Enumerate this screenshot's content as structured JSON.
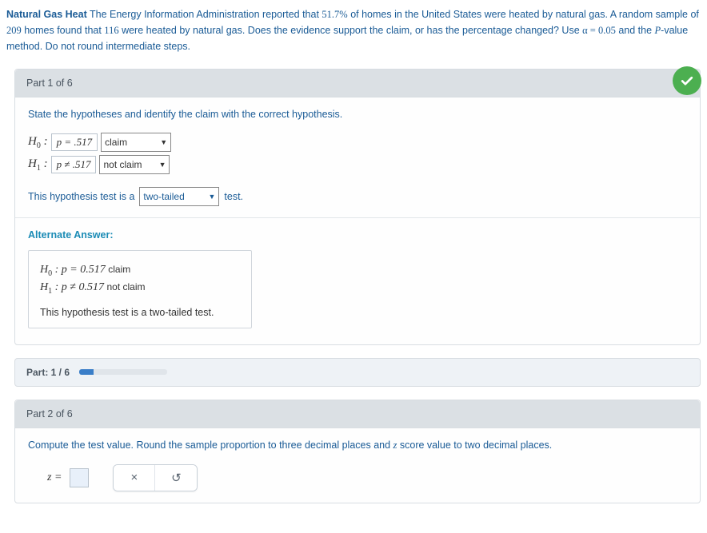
{
  "problem": {
    "title_bold": "Natural Gas Heat",
    "text_a": " The Energy Information Administration reported that ",
    "pct": "51.7%",
    "text_b": " of homes in the United States were heated by natural gas. A random sample of ",
    "n": "209",
    "text_c": " homes found that ",
    "x": "116",
    "text_d": " were heated by natural gas. Does the evidence support the claim, or has the percentage changed? Use ",
    "alpha_expr": "α = 0.05",
    "text_e": " and the ",
    "pvalue_var": "P",
    "text_f": "-value method. Do not round intermediate steps."
  },
  "part1": {
    "header": "Part 1 of 6",
    "instruction": "State the hypotheses and identify the claim with the correct hypothesis.",
    "h0_sym": "H",
    "h0_sub": "0",
    "colon": " : ",
    "h0_expr": "p = .517",
    "h0_claim": "claim",
    "h1_sym": "H",
    "h1_sub": "1",
    "h1_expr": "p ≠ .517",
    "h1_claim": "not claim",
    "sentence_a": "This hypothesis test is a",
    "tail_value": "two-tailed",
    "sentence_b": "test.",
    "alternate_title": "Alternate Answer:",
    "alt_h0": "H",
    "alt_h0_sub": "0",
    "alt_h0_expr": " : p = 0.517 ",
    "alt_h0_note": "claim",
    "alt_h1": "H",
    "alt_h1_sub": "1",
    "alt_h1_expr": " : p ≠ 0.517 ",
    "alt_h1_note": "not claim",
    "alt_sentence": "This hypothesis test is a two-tailed test."
  },
  "progress": {
    "label": "Part: 1 / 6"
  },
  "part2": {
    "header": "Part 2 of 6",
    "instruction_a": "Compute the test value. Round the sample proportion to three decimal places and ",
    "zvar": "z",
    "instruction_b": " score value to two decimal places.",
    "z_label": "z ="
  },
  "icons": {
    "clear": "×",
    "reset": "↺"
  }
}
